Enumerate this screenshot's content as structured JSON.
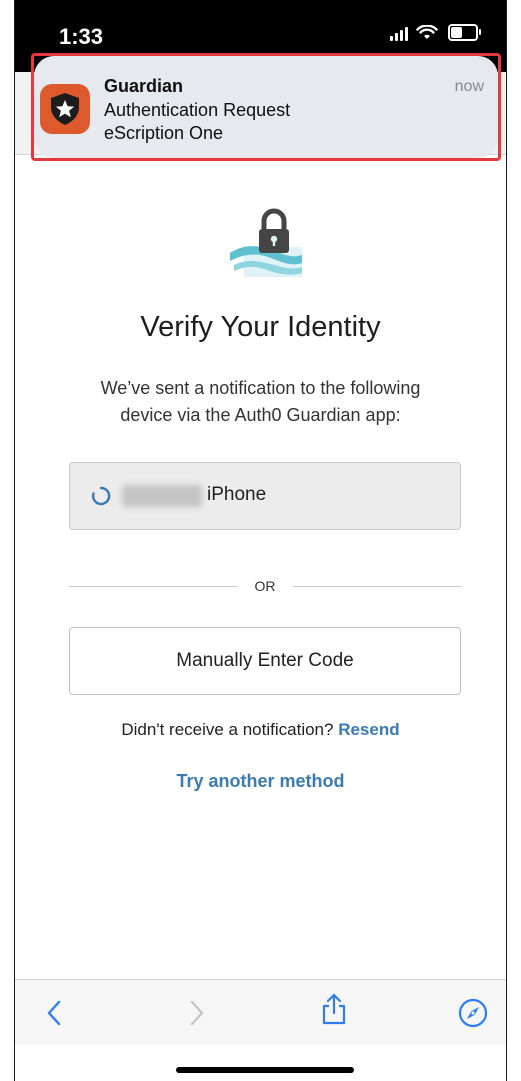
{
  "status_bar": {
    "time": "1:33"
  },
  "notification": {
    "app_name": "Guardian",
    "line1": "Authentication Request",
    "line2": "eScription One",
    "time": "now",
    "icon": "shield-star-icon",
    "icon_color": "#dd5a2d",
    "highlight_color": "#e5393f"
  },
  "page": {
    "logo": "lock-waves-icon",
    "title": "Verify Your Identity",
    "subtitle_line1": "We’ve sent a notification to the following",
    "subtitle_line2": "device via the Auth0 Guardian app:",
    "device": {
      "name_suffix": "iPhone",
      "status_icon": "spinner-icon"
    },
    "or_text": "OR",
    "manual_button": "Manually Enter Code",
    "resend_prompt": "Didn't receive a notification?",
    "resend_link": "Resend",
    "try_another": "Try another method",
    "link_color": "#3a7bb1"
  },
  "toolbar": {
    "back": "chevron-left-icon",
    "forward": "chevron-right-icon",
    "share": "share-icon",
    "safari": "compass-icon"
  }
}
